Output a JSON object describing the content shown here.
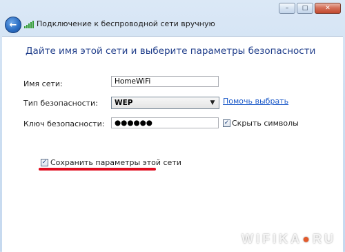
{
  "window": {
    "title": "Подключение к беспроводной сети вручную",
    "buttons": {
      "minimize": "–",
      "maximize": "□",
      "close": "✕"
    }
  },
  "content": {
    "heading": "Дайте имя этой сети и выберите параметры безопасности",
    "network_name": {
      "label": "Имя сети:",
      "value": "HomeWiFi"
    },
    "security_type": {
      "label": "Тип безопасности:",
      "value": "WEP",
      "help_link": "Помочь выбрать"
    },
    "security_key": {
      "label": "Ключ безопасности:",
      "value": "●●●●●●",
      "hide_chars_label": "Скрыть символы",
      "hide_chars_checked": true
    },
    "save_settings": {
      "label": "Сохранить параметры этой сети",
      "checked": true
    }
  },
  "watermark": {
    "text_left": "WIFIKA",
    "dot": "●",
    "text_right": "RU"
  },
  "colors": {
    "heading": "#1f3d8a",
    "link": "#1a58c8",
    "highlight": "#e00b1e"
  }
}
